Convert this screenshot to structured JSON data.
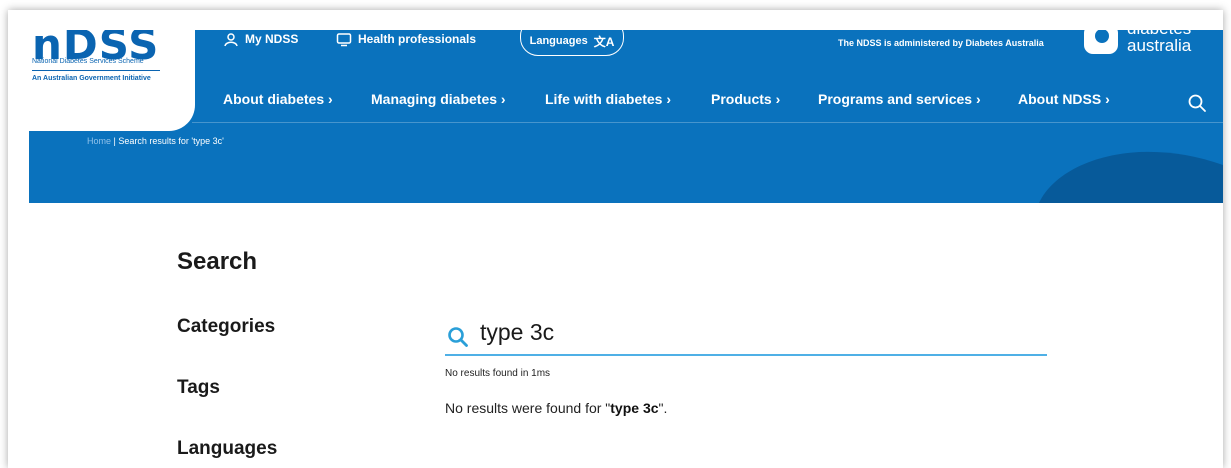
{
  "header": {
    "logo": {
      "wordmark": "nDSS",
      "line1": "National Diabetes Services Scheme",
      "line2": "An Australian Government Initiative"
    },
    "top_links": [
      {
        "label": "My NDSS",
        "icon": "user-icon"
      },
      {
        "label": "Health professionals",
        "icon": "monitor-icon"
      }
    ],
    "languages_label": "Languages",
    "languages_icon": "translate-icon",
    "admin_text": "The NDSS is administered by Diabetes Australia",
    "partner_logo": {
      "word1": "diabetes",
      "word2": "australia"
    },
    "nav": [
      {
        "label": "About diabetes ›"
      },
      {
        "label": "Managing diabetes ›"
      },
      {
        "label": "Life with diabetes ›"
      },
      {
        "label": "Products ›"
      },
      {
        "label": "Programs and services ›"
      },
      {
        "label": "About NDSS ›"
      }
    ],
    "search_icon": "search-icon"
  },
  "breadcrumb": {
    "home": "Home",
    "separator": " | ",
    "current": "Search results for 'type 3c'"
  },
  "main": {
    "title": "Search",
    "sidebar": [
      "Categories",
      "Tags",
      "Languages"
    ],
    "search": {
      "value": "type 3c",
      "icon": "search-icon"
    },
    "result_meta": "No results found in 1ms",
    "result_msg_prefix": "No results were found for \"",
    "result_msg_query": "type 3c",
    "result_msg_suffix": "\"."
  },
  "colors": {
    "brand_blue": "#0a72bd",
    "brand_dark": "#075a9a",
    "accent_line": "#4fb0e6",
    "search_icon": "#2a9fd8"
  }
}
